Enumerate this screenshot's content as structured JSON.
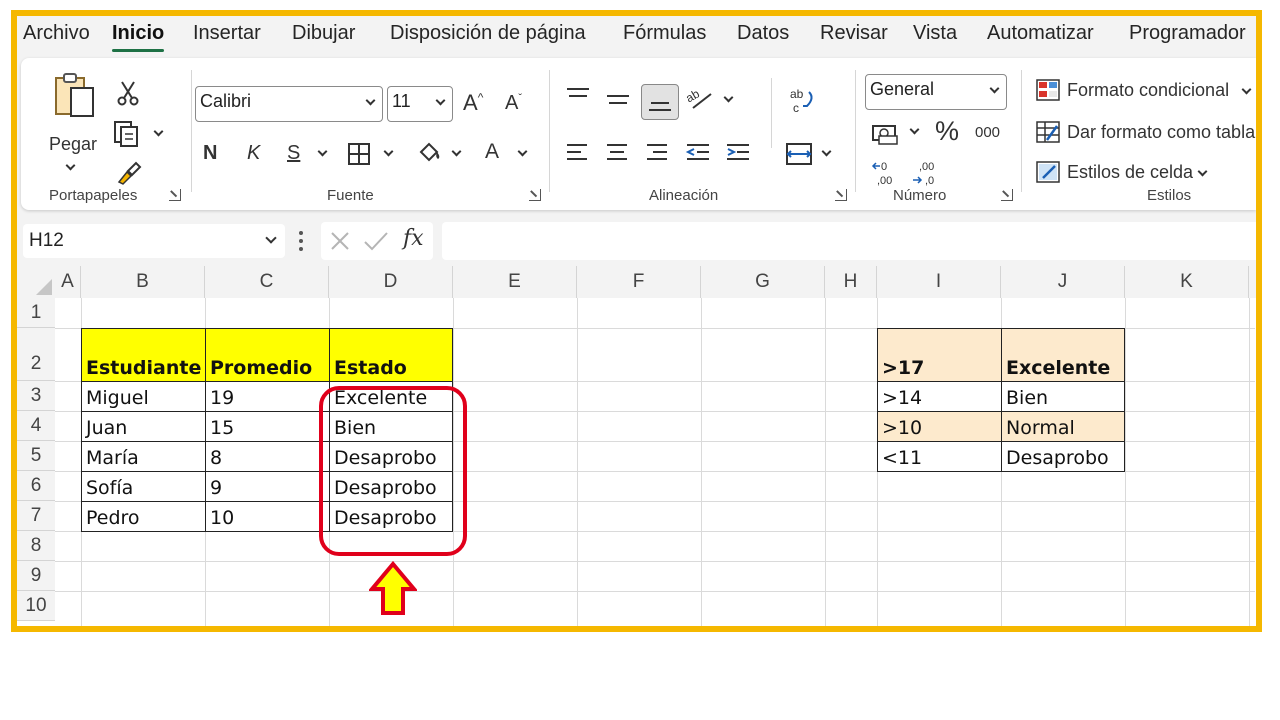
{
  "menu": {
    "tabs": [
      "Archivo",
      "Inicio",
      "Insertar",
      "Dibujar",
      "Disposición de página",
      "Fórmulas",
      "Datos",
      "Revisar",
      "Vista",
      "Automatizar",
      "Programador"
    ],
    "active_tab": "Inicio"
  },
  "ribbon": {
    "clipboard": {
      "paste_label": "Pegar",
      "group_label": "Portapapeles"
    },
    "font": {
      "font_name": "Calibri",
      "font_size": "11",
      "bold_label": "N",
      "italic_label": "K",
      "underline_label": "S",
      "font_color_label": "A",
      "group_label": "Fuente"
    },
    "alignment": {
      "group_label": "Alineación"
    },
    "number": {
      "format": "General",
      "percent_label": "%",
      "thousands_label": "000",
      "group_label": "Número"
    },
    "styles": {
      "conditional_format": "Formato condicional",
      "format_as_table": "Dar formato como tabla",
      "cell_styles": "Estilos de celda",
      "group_label": "Estilos"
    }
  },
  "formula_bar": {
    "name_box": "H12",
    "fx_label": "fx",
    "formula": ""
  },
  "columns": [
    "A",
    "B",
    "C",
    "D",
    "E",
    "F",
    "G",
    "H",
    "I",
    "J",
    "K"
  ],
  "rows": [
    "1",
    "2",
    "3",
    "4",
    "5",
    "6",
    "7",
    "8",
    "9",
    "10"
  ],
  "main_table": {
    "headers": [
      "Estudiante",
      "Promedio",
      "Estado"
    ],
    "rows": [
      [
        "Miguel",
        "19",
        "Excelente"
      ],
      [
        "Juan",
        "15",
        "Bien"
      ],
      [
        "María",
        "8",
        "Desaprobo"
      ],
      [
        "Sofía",
        "9",
        "Desaprobo"
      ],
      [
        "Pedro",
        "10",
        "Desaprobo"
      ]
    ],
    "header_color": "#ffff00"
  },
  "lookup_table": {
    "rows": [
      [
        ">17",
        "Excelente"
      ],
      [
        ">14",
        "Bien"
      ],
      [
        ">10",
        "Normal"
      ],
      [
        "<11",
        "Desaprobo"
      ]
    ],
    "highlight_color": "#fdeacd"
  },
  "annotation": {
    "circle_color": "#e0001b",
    "arrow_fill": "#ffff00",
    "arrow_stroke": "#e0001b"
  },
  "frame_color": "#f5b800"
}
